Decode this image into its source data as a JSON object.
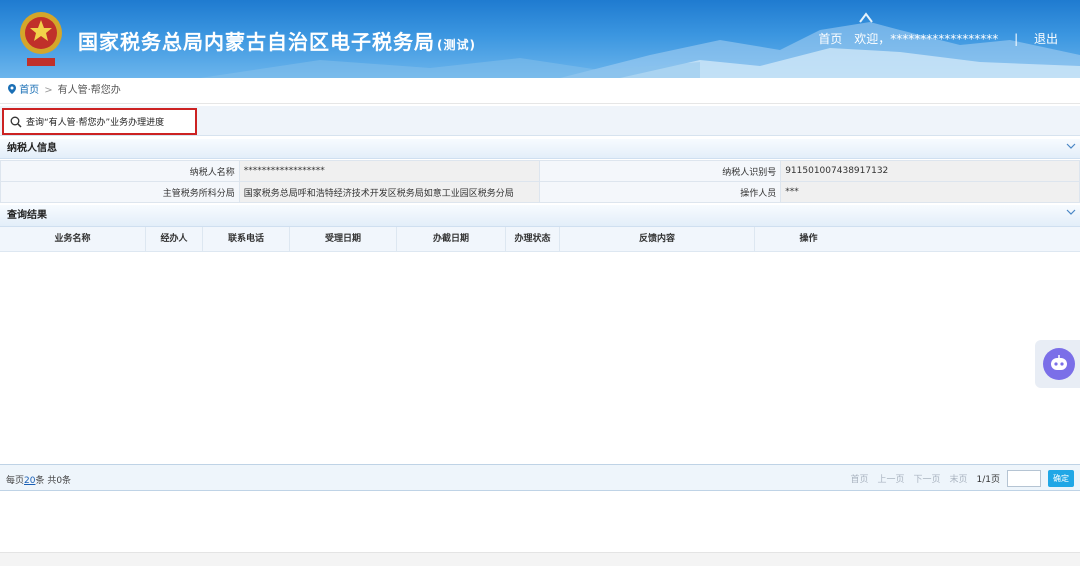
{
  "header": {
    "title": "国家税务总局内蒙古自治区电子税务局",
    "title_suffix": "(测试)",
    "links": {
      "home": "首页",
      "welcome": "欢迎，******************",
      "divider": "|",
      "logout": "退出"
    },
    "emblem_icon": "tax-emblem-icon"
  },
  "breadcrumb": {
    "home": "首页",
    "separator": ">",
    "current": "有人管·帮您办"
  },
  "toolbar": {
    "query_label": "查询“有人管·帮您办”业务办理进度"
  },
  "taxpayer_section": {
    "title": "纳税人信息",
    "rows": [
      {
        "label1": "纳税人名称",
        "value1": "******************",
        "label2": "纳税人识别号",
        "value2": "911501007438917132"
      },
      {
        "label1": "主管税务所科分局",
        "value1": "国家税务总局呼和浩特经济技术开发区税务局如意工业园区税务分局",
        "label2": "操作人员",
        "value2": "***"
      }
    ]
  },
  "results_section": {
    "title": "查询结果",
    "columns": [
      "业务名称",
      "经办人",
      "联系电话",
      "受理日期",
      "办截日期",
      "办理状态",
      "反馈内容",
      "操作"
    ]
  },
  "pager": {
    "per_page_prefix": "每页",
    "per_page_value": "20",
    "per_page_suffix": "条 共0条",
    "first": "首页",
    "prev": "上一页",
    "next": "下一页",
    "last": "末页",
    "page_info": "1/1页",
    "go_label": "确定"
  },
  "colors": {
    "header_blue": "#2b86d8",
    "highlight_red": "#cc2222",
    "link_blue": "#1a5fb4",
    "confirm_button": "#21a7e6"
  }
}
